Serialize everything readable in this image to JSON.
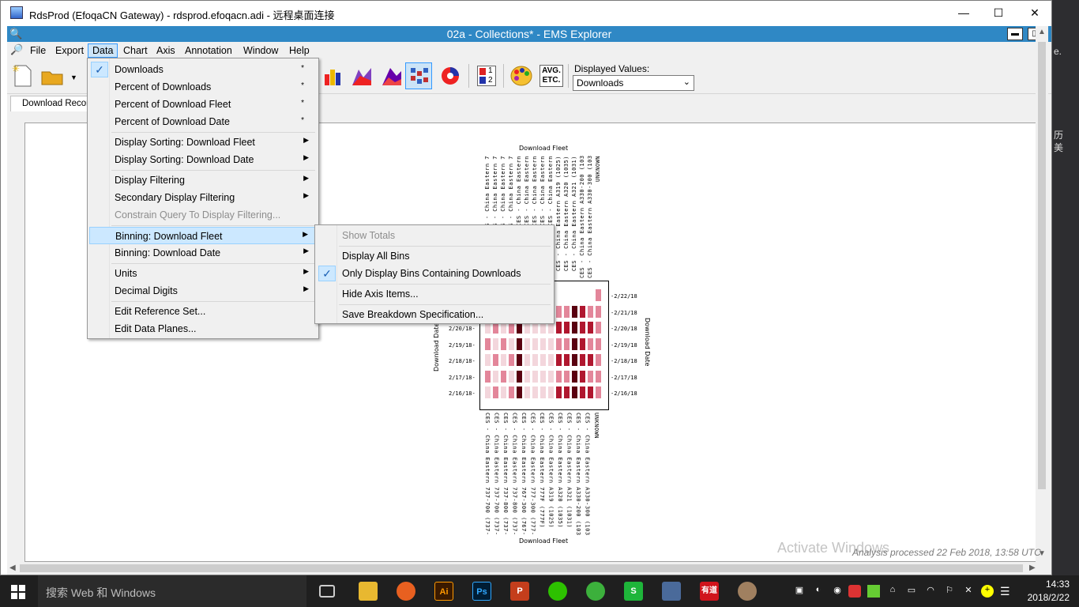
{
  "rdp": {
    "title": "RdsProd (EfoqaCN Gateway) - rdsprod.efoqacn.adi - 远程桌面连接",
    "minimize": "—",
    "maximize": "☐",
    "close": "✕"
  },
  "app": {
    "title": "02a - Collections* - EMS Explorer",
    "search_glyph": "🔍",
    "restore": "▬",
    "close": "◫"
  },
  "menubar": [
    "File",
    "Export",
    "Data",
    "Chart",
    "Axis",
    "Annotation",
    "Window",
    "Help"
  ],
  "toolbar": {
    "displayed_values_label": "Displayed Values:",
    "displayed_values_selected": "Downloads",
    "legend_12_top": "1",
    "legend_12_bottom": "2",
    "avg_label_1": "AVG.",
    "avg_label_2": "ETC."
  },
  "tab": {
    "label": "Download Record"
  },
  "data_menu": {
    "items": [
      {
        "label": "Downloads",
        "star": "*",
        "checked": true
      },
      {
        "label": "Percent of Downloads",
        "star": "*"
      },
      {
        "label": "Percent of Download Fleet",
        "star": "*"
      },
      {
        "label": "Percent of Download Date",
        "star": "*"
      },
      {
        "label": "Display Sorting: Download Fleet",
        "submenu": true
      },
      {
        "label": "Display Sorting: Download Date",
        "submenu": true
      },
      {
        "label": "Display Filtering",
        "submenu": true
      },
      {
        "label": "Secondary Display Filtering",
        "submenu": true
      },
      {
        "label": "Constrain Query To Display Filtering...",
        "disabled": true
      },
      {
        "label": "Binning: Download Fleet",
        "submenu": true,
        "highlighted": true
      },
      {
        "label": "Binning: Download Date",
        "submenu": true
      },
      {
        "label": "Units",
        "submenu": true
      },
      {
        "label": "Decimal Digits",
        "submenu": true
      },
      {
        "label": "Edit Reference Set..."
      },
      {
        "label": "Edit Data Planes..."
      }
    ]
  },
  "binning_submenu": {
    "items": [
      {
        "label": "Show Totals",
        "disabled": true
      },
      {
        "label": "Display All Bins"
      },
      {
        "label": "Only Display Bins Containing Downloads",
        "checked": true
      },
      {
        "label": "Hide Axis Items..."
      },
      {
        "label": "Save Breakdown Specification..."
      }
    ]
  },
  "chart": {
    "x_title_top": "Download Fleet",
    "x_title_bottom": "Download Fleet",
    "y_title_left": "Download Date",
    "y_title_right": "Download Date",
    "top_labels": [
      "CES - China Eastern 7",
      "CES - China Eastern 7",
      "CES - China Eastern 7",
      "CES - China Eastern 7",
      "CES - China Eastern",
      "CES - China Eastern",
      "CES - China Eastern",
      "CES - China Eastern",
      "CES - China Eastern",
      "CES - China Eastern A319 (1025)",
      "CES - China Eastern A320 (1035)",
      "CES - China Eastern A321 (1031)",
      "CES - China Eastern A330-200 (1031)",
      "CES - China Eastern A330-300 (1031)",
      "UNKNOWN"
    ],
    "bottom_labels": [
      "CES - China Eastern 737-700 (737-30)",
      "CES - China Eastern 737-700 (737-30)",
      "CES - China Eastern 737-800 (737-33)",
      "CES - China Eastern 737-800 (737-73)",
      "CES - China Eastern 767-300 (767-35)",
      "CES - China Eastern 777-300 (777-3S)",
      "CES - China Eastern 777F (777F)",
      "CES - China Eastern A319 (1025)",
      "CES - China Eastern A320 (1035)",
      "CES - China Eastern A321 (1031)",
      "CES - China Eastern A330-200 (1031)",
      "CES - China Eastern A330-300 (1031)",
      "UNKNOWN"
    ],
    "dates": [
      "2/22/18",
      "2/21/18",
      "2/20/18",
      "2/19/18",
      "2/18/18",
      "2/17/18",
      "2/16/18"
    ],
    "left_dates_visible": [
      "2/20/18",
      "2/19/18",
      "2/18/18",
      "2/17/18",
      "2/16/18"
    ],
    "colors": {
      "low": "#f3d6dc",
      "mid": "#e3869a",
      "high": "#b0172f",
      "max": "#5a0010"
    }
  },
  "status": {
    "watermark": "Activate Windows",
    "analysis": "Analysis processed 22 Feb 2018, 13:58 UTC"
  },
  "taskbar": {
    "search_placeholder": "搜索 Web 和 Windows",
    "time": "14:33",
    "date": "2018/2/22",
    "apps": [
      "task-view",
      "file-explorer",
      "firefox",
      "illustrator",
      "photoshop",
      "powerpoint",
      "wechat",
      "360",
      "wps",
      "rdp",
      "youdao",
      "avatar"
    ]
  },
  "right_edge": {
    "text1": "e.",
    "text2": "历",
    "text3": "美"
  }
}
